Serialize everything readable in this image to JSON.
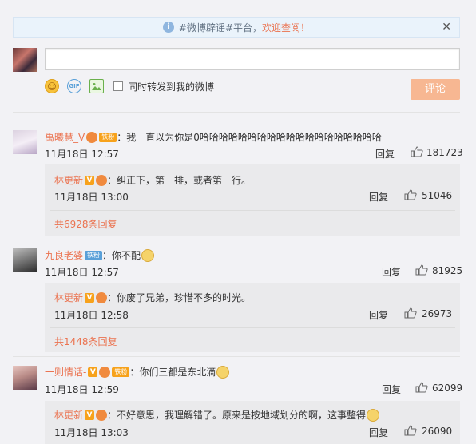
{
  "notice": {
    "prefix": "#微博辟谣#平台，",
    "link": "欢迎查阅！",
    "info_icon": "info-icon",
    "close": "✕"
  },
  "compose": {
    "sync_label": "同时转发到我的微博",
    "submit_label": "评论"
  },
  "comments": [
    {
      "user": "禹曦慧_V",
      "fan_badge": "铁粉",
      "text": "：我一直以为你是0哈哈哈哈哈哈哈哈哈哈哈哈哈哈哈哈哈哈哈",
      "time": "11月18日 12:57",
      "reply_label": "回复",
      "likes": "181723",
      "sub": {
        "user": "林更新",
        "text": "：纠正下，第一排，或者第一行。",
        "time": "11月18日 13:00",
        "reply_label": "回复",
        "likes": "51046"
      },
      "more": "共6928条回复"
    },
    {
      "user": "九良老婆",
      "fan_badge": "铁粉",
      "text": "：你不配",
      "time": "11月18日 12:57",
      "reply_label": "回复",
      "likes": "81925",
      "sub": {
        "user": "林更新",
        "text": "：你废了兄弟，珍惜不多的时光。",
        "time": "11月18日 12:58",
        "reply_label": "回复",
        "likes": "26973"
      },
      "more": "共1448条回复"
    },
    {
      "user": "一则情话-",
      "fan_badge": "铁粉",
      "text": "：你们三都是东北滴",
      "time": "11月18日 12:59",
      "reply_label": "回复",
      "likes": "62099",
      "sub": {
        "user": "林更新",
        "text": "：不好意思，我理解错了。原来是按地域划分的啊，这事整得",
        "time": "11月18日 13:03",
        "reply_label": "回复",
        "likes": "26090"
      }
    }
  ],
  "colors": {
    "accent": "#eb7350",
    "button": "#f7b792",
    "background": "#f2f2f5",
    "sub_background": "#eaeaec"
  }
}
